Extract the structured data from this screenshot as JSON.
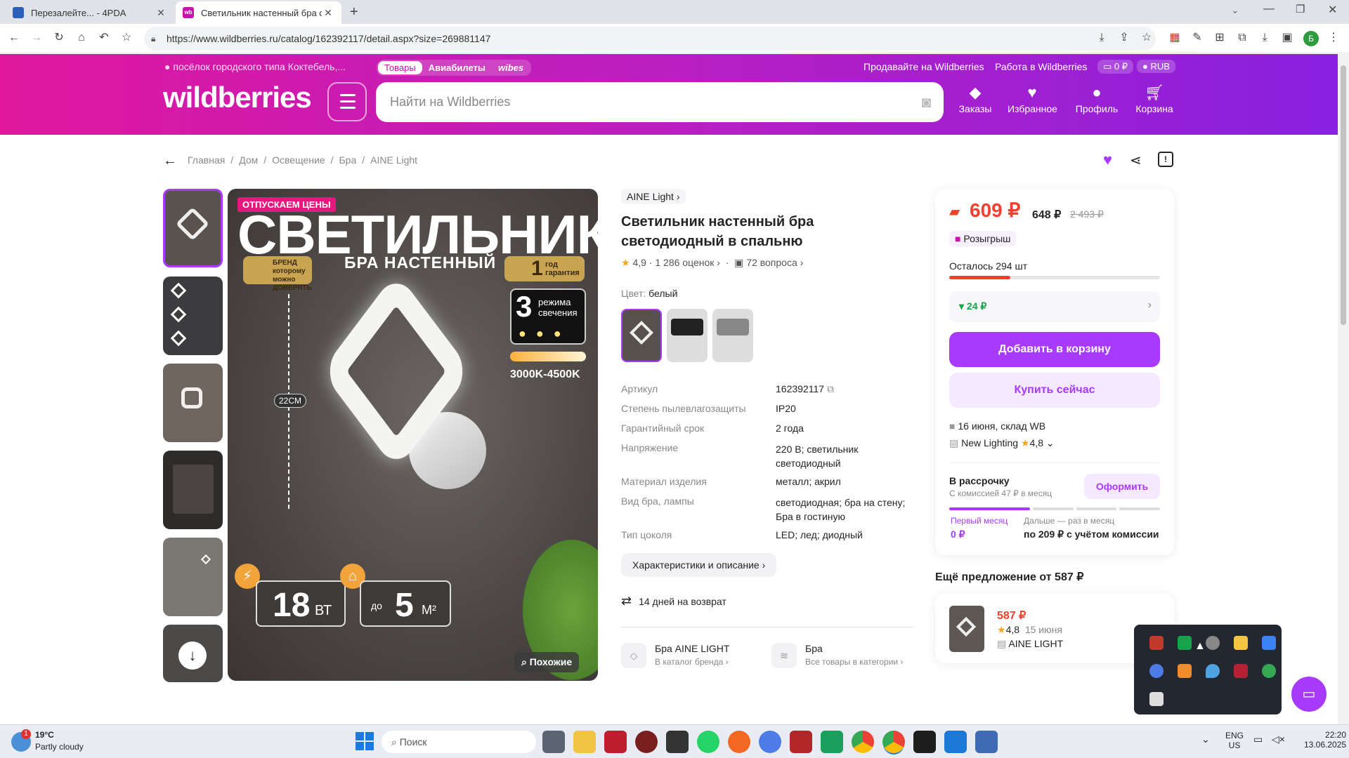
{
  "browser": {
    "tabs": [
      {
        "title": "Перезалейте... - 4PDA"
      },
      {
        "title": "Светильник настенный бра све"
      }
    ],
    "url": "https://www.wildberries.ru/catalog/162392117/detail.aspx?size=269881147"
  },
  "header": {
    "location": "посёлок городского типа Коктебель,...",
    "top_tabs": [
      "Товары",
      "Авиабилеты",
      "wibes"
    ],
    "links": [
      "Продавайте на Wildberries",
      "Работа в Wildberries"
    ],
    "balance": "0 ₽",
    "currency": "RUB",
    "logo": "wildberries",
    "search_placeholder": "Найти на Wildberries",
    "nav": [
      "Заказы",
      "Избранное",
      "Профиль",
      "Корзина"
    ]
  },
  "breadcrumbs": [
    "Главная",
    "Дом",
    "Освещение",
    "Бра",
    "AINE Light"
  ],
  "image": {
    "badge": "ОТПУСКАЕМ ЦЕНЫ",
    "title": "СВЕТИЛЬНИК",
    "subtitle": "БРА НАСТЕННЫЙ",
    "brand_badge": "БРЕНД которому можно ДОВЕРЯТЬ",
    "warranty_num": "1",
    "warranty_text": "год гарантия",
    "modes_num": "3",
    "modes_text": "режима свечения",
    "temp": "3000K-4500K",
    "height": "22CM",
    "watts_num": "18",
    "watts_unit": "ВТ",
    "area_pre": "до",
    "area_num": "5",
    "area_unit": "М²",
    "similar": "Похожие"
  },
  "product": {
    "brand": "AINE Light",
    "title": "Светильник настенный бра светодиодный в спальню",
    "rating": "4,9",
    "reviews": "1 286 оценок",
    "questions": "72 вопроса",
    "color_label": "Цвет:",
    "color_value": "белый",
    "specs": [
      {
        "k": "Артикул",
        "v": "162392117"
      },
      {
        "k": "Степень пылевлагозащиты",
        "v": "IP20"
      },
      {
        "k": "Гарантийный срок",
        "v": "2 года"
      },
      {
        "k": "Напряжение",
        "v": "220 В; светильник светодиодный"
      },
      {
        "k": "Материал изделия",
        "v": "металл; акрил"
      },
      {
        "k": "Вид бра, лампы",
        "v": "светодиодная; бра на стену; Бра в гостиную"
      },
      {
        "k": "Тип цоколя",
        "v": "LED; лед; диодный"
      }
    ],
    "more_button": "Характеристики и описание",
    "return_text": "14 дней на возврат",
    "brand_link": {
      "title": "Бра AINE LIGHT",
      "sub": "В каталог бренда"
    },
    "cat_link": {
      "title": "Бра",
      "sub": "Все товары в категории"
    }
  },
  "buy": {
    "price": "609 ₽",
    "price2": "648 ₽",
    "old_price": "2 493 ₽",
    "raffle": "Розыгрыш",
    "stock": "Осталось 294 шт",
    "stock_fill": 0.29,
    "price_drop": "▾ 24 ₽",
    "add_cart": "Добавить в корзину",
    "buy_now": "Купить сейчас",
    "delivery": "16 июня, склад WB",
    "seller": "New Lighting",
    "seller_rating": "4,8",
    "installment_title": "В рассрочку",
    "installment_sub": "С комиссией 47 ₽ в месяц",
    "installment_btn": "Оформить",
    "first_month": "Первый месяц",
    "first_price": "0 ₽",
    "then_label": "Дальше — раз в месяц",
    "then_price": "по 209 ₽ с учётом комиссии"
  },
  "offer": {
    "title": "Ещё предложение от 587 ₽",
    "price": "587 ₽",
    "rating": "4,8",
    "date": "15 июня",
    "seller": "AINE LIGHT"
  },
  "taskbar": {
    "temp": "19°C",
    "weather": "Partly cloudy",
    "search": "Поиск",
    "lang1": "ENG",
    "lang2": "US",
    "time": "22:20",
    "date": "13.06.2025"
  }
}
